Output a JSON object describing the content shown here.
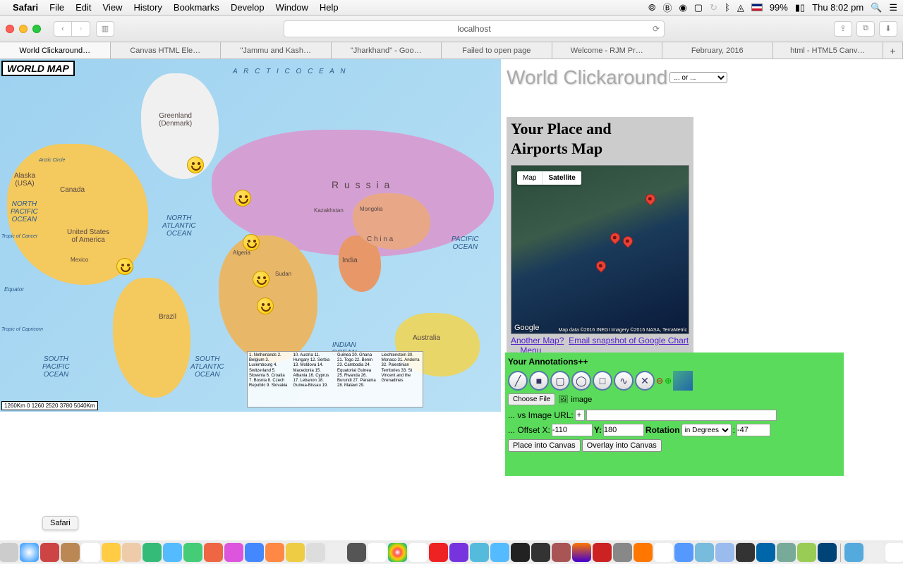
{
  "menubar": {
    "app": "Safari",
    "items": [
      "File",
      "Edit",
      "View",
      "History",
      "Bookmarks",
      "Develop",
      "Window",
      "Help"
    ],
    "battery": "99%",
    "clock": "Thu 8:02 pm"
  },
  "safari": {
    "address": "localhost",
    "tabs": [
      "World Clickaround…",
      "Canvas HTML Ele…",
      "\"Jammu and Kash…",
      "\"Jharkhand\" - Goo…",
      "Failed to open page",
      "Welcome - RJM Pr…",
      "February, 2016",
      "html - HTML5 Canv…"
    ]
  },
  "worldmap": {
    "badge": "WORLD MAP",
    "oceans": {
      "arctic": "A R C T I C     O C E A N",
      "npacific": "NORTH\nPACIFIC\nOCEAN",
      "natlantic": "NORTH\nATLANTIC\nOCEAN",
      "satlantic": "SOUTH\nATLANTIC\nOCEAN",
      "spacific": "SOUTH\nPACIFIC\nOCEAN",
      "indian": "INDIAN\nOCEAN",
      "pacific2": "PACIFIC\nOCEAN"
    },
    "countries": {
      "russia": "R u s s i a",
      "canada": "Canada",
      "usa": "United States\nof America",
      "alaska": "Alaska\n(USA)",
      "greenland": "Greenland\n(Denmark)",
      "china": "C h i n a",
      "india": "India",
      "brazil": "Brazil",
      "australia": "Australia",
      "mongolia": "Mongolia",
      "kazakhstan": "Kazakhstan",
      "mexico": "Mexico",
      "algeria": "Algeria",
      "sudan": "Sudan"
    },
    "scale": "1260Km   0   1260  2520  3780  5040Km",
    "lines": {
      "equator": "Equator",
      "cancer": "Tropic of Cancer",
      "capricorn": "Tropic of Capricorn",
      "arctic": "Arctic Circle"
    }
  },
  "right": {
    "title": "World Clickaround",
    "select_label": "... or ...",
    "place_heading1": "Your Place and",
    "place_heading2": "Airports Map",
    "map_btn": "Map",
    "sat_btn": "Satellite",
    "gmap_logo": "Google",
    "gmap_attr": "Map data ©2016 INEGI Imagery ©2016 NASA, TerraMetric",
    "link_another": "Another Map?",
    "link_email": "Email snapshot of Google Chart ...",
    "link_menu": "Menu"
  },
  "annot": {
    "heading": "Your Annotations++",
    "choose_file": "Choose File",
    "image_lbl": "image",
    "vs_label": "... vs Image URL:",
    "url_prefix": "+",
    "offset_label": "... Offset X:",
    "offset_x": "-110",
    "y_label": "Y:",
    "offset_y": "180",
    "rotation_label": "Rotation",
    "rotation_unit": "in Degrees",
    "rotation_val": "-47",
    "place_btn": "Place into Canvas",
    "overlay_btn": "Overlay into Canvas"
  },
  "dock": {
    "tooltip": "Safari",
    "icons": [
      "finder",
      "launchpad",
      "safari",
      "mail",
      "contacts",
      "calendar",
      "notes",
      "reminders",
      "maps",
      "photos",
      "messages",
      "facetime",
      "itunes",
      "appstore",
      "ibooks",
      "preview",
      "terminal",
      "xcode",
      "chrome",
      "textedit",
      "opera",
      "star",
      "mail2",
      "skype",
      "term2",
      "term3",
      "app1",
      "firefox",
      "filezilla",
      "app2",
      "vlc",
      "app3",
      "help",
      "box1",
      "box2",
      "biz",
      "vbox",
      "php",
      "app4",
      "steam"
    ],
    "tray": [
      "folder",
      "doc",
      "web",
      "trash"
    ]
  }
}
